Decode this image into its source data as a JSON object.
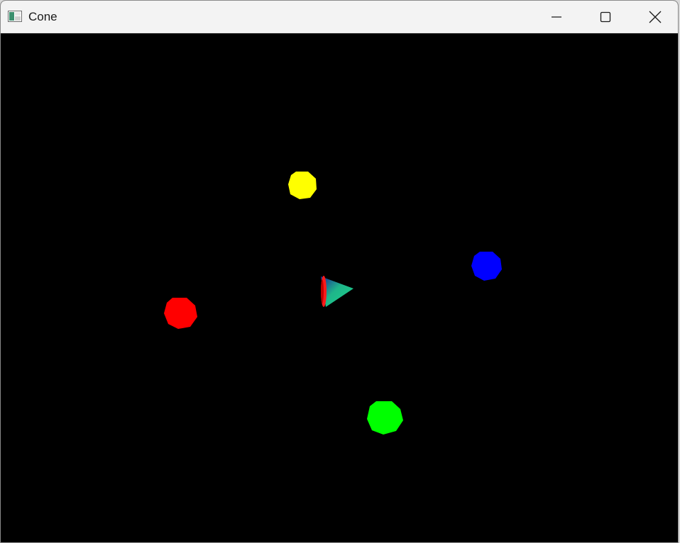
{
  "window": {
    "title": "Cone",
    "icon": "app-window-icon",
    "controls": [
      "minimize-icon",
      "maximize-icon",
      "close-icon"
    ]
  },
  "scene": {
    "background_color": "#000000",
    "spheres": [
      {
        "name": "yellow",
        "color": "#ffff00"
      },
      {
        "name": "blue",
        "color": "#0000ff"
      },
      {
        "name": "red",
        "color": "#ff0000"
      },
      {
        "name": "green",
        "color": "#00ff00"
      }
    ],
    "cone": {
      "base_color": "#ff0000",
      "side_colors": [
        "#1a2a9a",
        "#1fb58a",
        "#1ad48a"
      ]
    }
  }
}
